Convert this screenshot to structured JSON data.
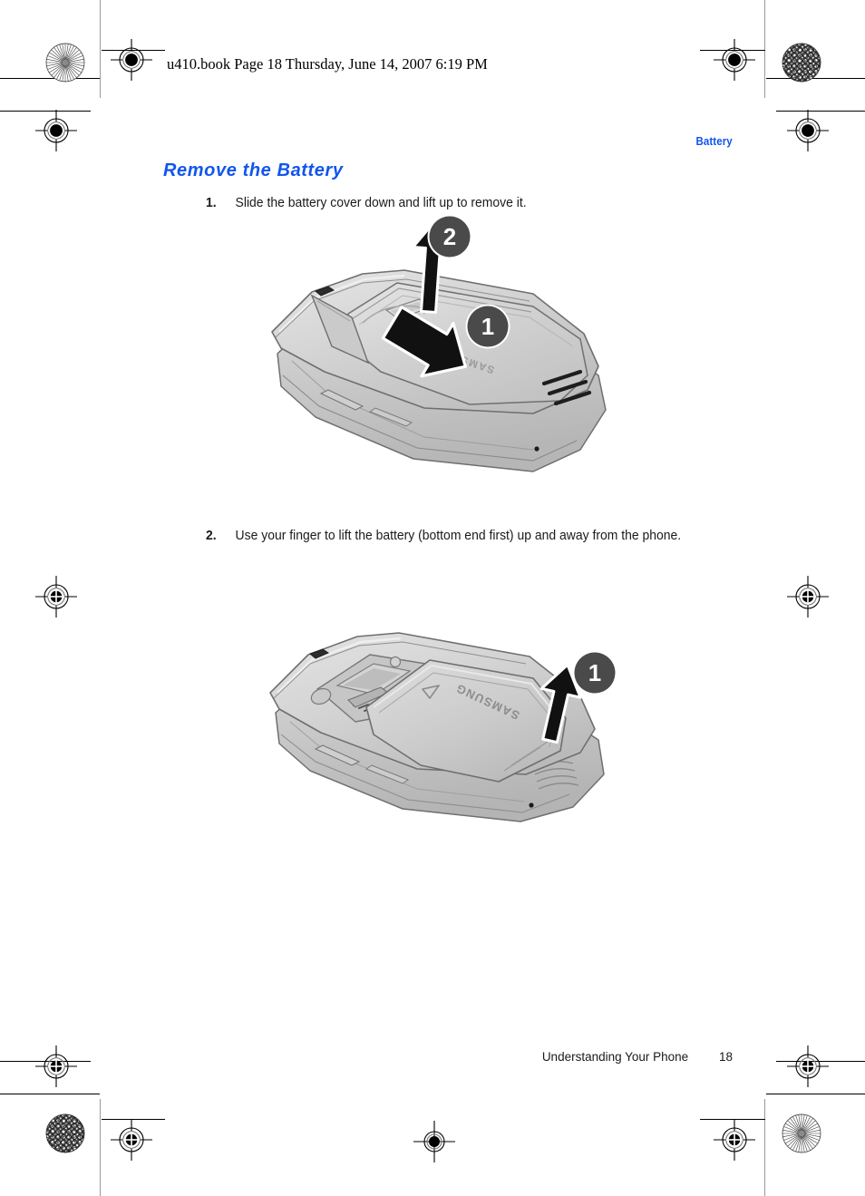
{
  "document": {
    "print_header": "u410.book  Page 18  Thursday, June 14, 2007  6:19 PM",
    "running_header": "Battery",
    "section_heading": "Remove the Battery",
    "footer_chapter": "Understanding Your Phone",
    "footer_page_number": "18"
  },
  "steps": [
    {
      "number": "1.",
      "text": "Slide the battery cover down and lift up to remove it."
    },
    {
      "number": "2.",
      "text": "Use your finger to lift the battery (bottom end first) up and away from the phone."
    }
  ],
  "figures": [
    {
      "id": "figure-1",
      "caption_step": "1",
      "description": "Closed flip phone viewed from the back, battery cover being slid down and lifted off",
      "brand_label": "SAMSUNG",
      "callouts": [
        {
          "label": "1",
          "meaning": "slide-cover-down"
        },
        {
          "label": "2",
          "meaning": "lift-cover-up"
        }
      ]
    },
    {
      "id": "figure-2",
      "caption_step": "2",
      "description": "Phone with battery cover removed showing battery in compartment being lifted out",
      "brand_label": "SAMSUNG",
      "callouts": [
        {
          "label": "1",
          "meaning": "lift-battery-up-and-away"
        }
      ]
    }
  ],
  "colors": {
    "accent_blue": "#1155ee",
    "text_black": "#1a1a1a",
    "callout_gray": "#4a4a4a",
    "phone_body": "#d2d2d2",
    "phone_shade": "#bcbcbc",
    "phone_highlight": "#e4e4e4",
    "phone_outline": "#6b6b6b"
  },
  "print_marks": {
    "registration_icon": "registration-target-icon",
    "rosette_icon": "color-rosette-icon"
  }
}
